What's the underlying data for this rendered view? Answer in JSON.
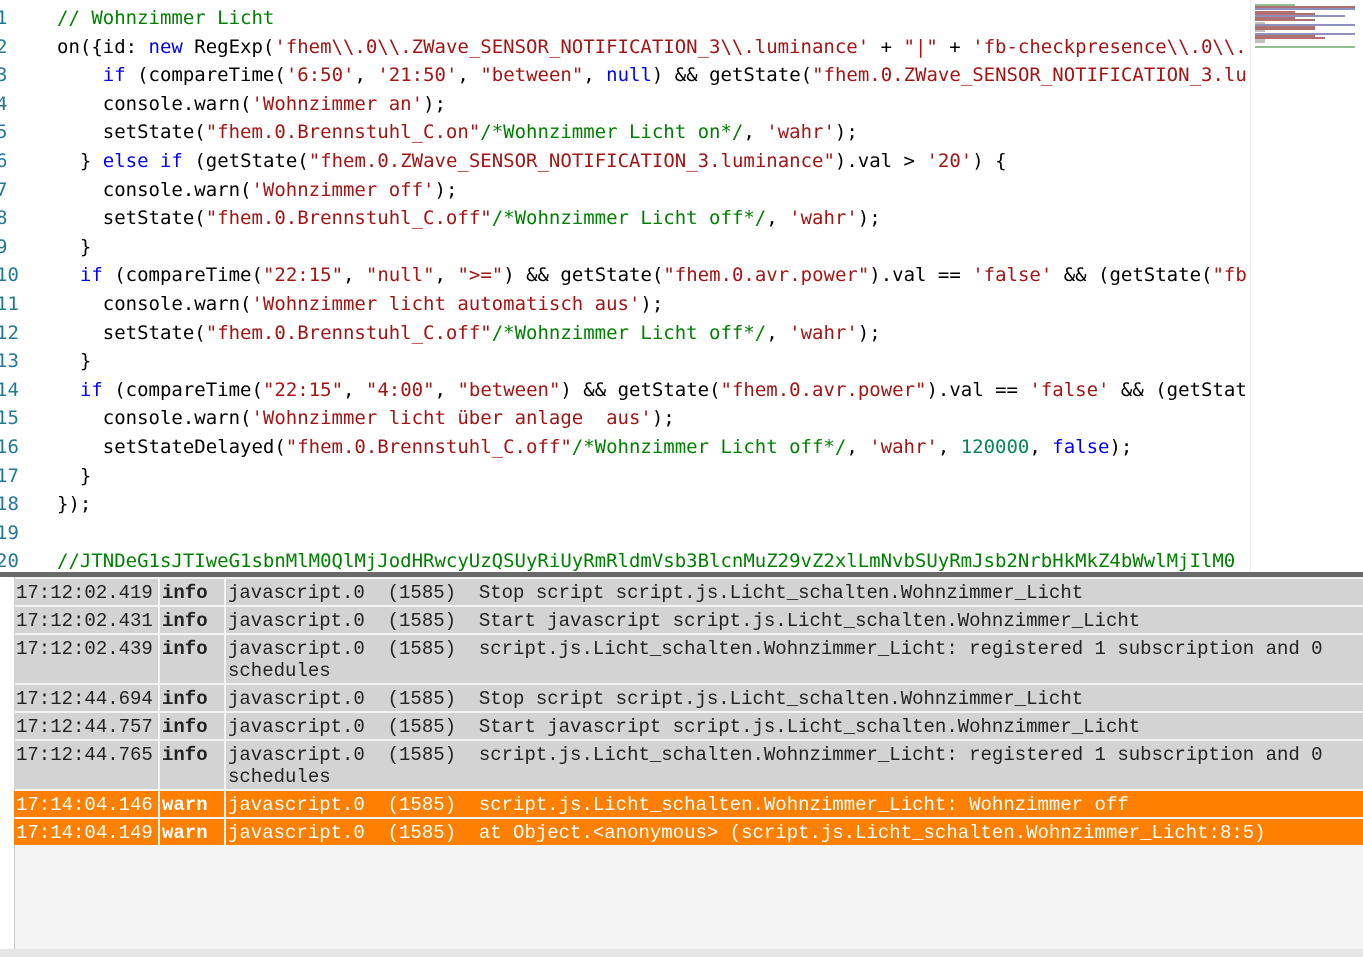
{
  "editor": {
    "lines": [
      {
        "n": "1",
        "tokens": [
          {
            "t": "// Wohnzimmer Licht",
            "c": "com"
          }
        ]
      },
      {
        "n": "2",
        "tokens": [
          {
            "t": "on({id: ",
            "c": "plain"
          },
          {
            "t": "new",
            "c": "kw"
          },
          {
            "t": " RegExp(",
            "c": "plain"
          },
          {
            "t": "'fhem\\\\.0\\\\.ZWave_SENSOR_NOTIFICATION_3\\\\.luminance'",
            "c": "str"
          },
          {
            "t": " + ",
            "c": "plain"
          },
          {
            "t": "\"|\"",
            "c": "str"
          },
          {
            "t": " + ",
            "c": "plain"
          },
          {
            "t": "'fb-checkpresence\\\\.0\\\\.",
            "c": "str"
          }
        ]
      },
      {
        "n": "3",
        "tokens": [
          {
            "t": "    ",
            "c": "plain"
          },
          {
            "t": "if",
            "c": "kw"
          },
          {
            "t": " (compareTime(",
            "c": "plain"
          },
          {
            "t": "'6:50'",
            "c": "str"
          },
          {
            "t": ", ",
            "c": "plain"
          },
          {
            "t": "'21:50'",
            "c": "str"
          },
          {
            "t": ", ",
            "c": "plain"
          },
          {
            "t": "\"between\"",
            "c": "str"
          },
          {
            "t": ", ",
            "c": "plain"
          },
          {
            "t": "null",
            "c": "kw"
          },
          {
            "t": ") && getState(",
            "c": "plain"
          },
          {
            "t": "\"fhem.0.ZWave_SENSOR_NOTIFICATION_3.lu",
            "c": "str"
          }
        ]
      },
      {
        "n": "4",
        "tokens": [
          {
            "t": "    console.warn(",
            "c": "plain"
          },
          {
            "t": "'Wohnzimmer an'",
            "c": "str"
          },
          {
            "t": ");",
            "c": "plain"
          }
        ]
      },
      {
        "n": "5",
        "tokens": [
          {
            "t": "    setState(",
            "c": "plain"
          },
          {
            "t": "\"fhem.0.Brennstuhl_C.on\"",
            "c": "str"
          },
          {
            "t": "/*Wohnzimmer Licht on*/",
            "c": "com"
          },
          {
            "t": ", ",
            "c": "plain"
          },
          {
            "t": "'wahr'",
            "c": "str"
          },
          {
            "t": ");",
            "c": "plain"
          }
        ]
      },
      {
        "n": "6",
        "tokens": [
          {
            "t": "  } ",
            "c": "plain"
          },
          {
            "t": "else",
            "c": "kw"
          },
          {
            "t": " ",
            "c": "plain"
          },
          {
            "t": "if",
            "c": "kw"
          },
          {
            "t": " (getState(",
            "c": "plain"
          },
          {
            "t": "\"fhem.0.ZWave_SENSOR_NOTIFICATION_3.luminance\"",
            "c": "str"
          },
          {
            "t": ").val > ",
            "c": "plain"
          },
          {
            "t": "'20'",
            "c": "str"
          },
          {
            "t": ") {",
            "c": "plain"
          }
        ]
      },
      {
        "n": "7",
        "tokens": [
          {
            "t": "    console.warn(",
            "c": "plain"
          },
          {
            "t": "'Wohnzimmer off'",
            "c": "str"
          },
          {
            "t": ");",
            "c": "plain"
          }
        ]
      },
      {
        "n": "8",
        "tokens": [
          {
            "t": "    setState(",
            "c": "plain"
          },
          {
            "t": "\"fhem.0.Brennstuhl_C.off\"",
            "c": "str"
          },
          {
            "t": "/*Wohnzimmer Licht off*/",
            "c": "com"
          },
          {
            "t": ", ",
            "c": "plain"
          },
          {
            "t": "'wahr'",
            "c": "str"
          },
          {
            "t": ");",
            "c": "plain"
          }
        ]
      },
      {
        "n": "9",
        "tokens": [
          {
            "t": "  }",
            "c": "plain"
          }
        ]
      },
      {
        "n": "10",
        "tokens": [
          {
            "t": "  ",
            "c": "plain"
          },
          {
            "t": "if",
            "c": "kw"
          },
          {
            "t": " (compareTime(",
            "c": "plain"
          },
          {
            "t": "\"22:15\"",
            "c": "str"
          },
          {
            "t": ", ",
            "c": "plain"
          },
          {
            "t": "\"null\"",
            "c": "str"
          },
          {
            "t": ", ",
            "c": "plain"
          },
          {
            "t": "\">=\"",
            "c": "str"
          },
          {
            "t": ") && getState(",
            "c": "plain"
          },
          {
            "t": "\"fhem.0.avr.power\"",
            "c": "str"
          },
          {
            "t": ").val == ",
            "c": "plain"
          },
          {
            "t": "'false'",
            "c": "str"
          },
          {
            "t": " && (getState(",
            "c": "plain"
          },
          {
            "t": "\"fb",
            "c": "str"
          }
        ]
      },
      {
        "n": "11",
        "tokens": [
          {
            "t": "    console.warn(",
            "c": "plain"
          },
          {
            "t": "'Wohnzimmer licht automatisch aus'",
            "c": "str"
          },
          {
            "t": ");",
            "c": "plain"
          }
        ]
      },
      {
        "n": "12",
        "tokens": [
          {
            "t": "    setState(",
            "c": "plain"
          },
          {
            "t": "\"fhem.0.Brennstuhl_C.off\"",
            "c": "str"
          },
          {
            "t": "/*Wohnzimmer Licht off*/",
            "c": "com"
          },
          {
            "t": ", ",
            "c": "plain"
          },
          {
            "t": "'wahr'",
            "c": "str"
          },
          {
            "t": ");",
            "c": "plain"
          }
        ]
      },
      {
        "n": "13",
        "tokens": [
          {
            "t": "  }",
            "c": "plain"
          }
        ]
      },
      {
        "n": "14",
        "tokens": [
          {
            "t": "  ",
            "c": "plain"
          },
          {
            "t": "if",
            "c": "kw"
          },
          {
            "t": " (compareTime(",
            "c": "plain"
          },
          {
            "t": "\"22:15\"",
            "c": "str"
          },
          {
            "t": ", ",
            "c": "plain"
          },
          {
            "t": "\"4:00\"",
            "c": "str"
          },
          {
            "t": ", ",
            "c": "plain"
          },
          {
            "t": "\"between\"",
            "c": "str"
          },
          {
            "t": ") && getState(",
            "c": "plain"
          },
          {
            "t": "\"fhem.0.avr.power\"",
            "c": "str"
          },
          {
            "t": ").val == ",
            "c": "plain"
          },
          {
            "t": "'false'",
            "c": "str"
          },
          {
            "t": " && (getStat",
            "c": "plain"
          }
        ]
      },
      {
        "n": "15",
        "tokens": [
          {
            "t": "    console.warn(",
            "c": "plain"
          },
          {
            "t": "'Wohnzimmer licht über anlage  aus'",
            "c": "str"
          },
          {
            "t": ");",
            "c": "plain"
          }
        ]
      },
      {
        "n": "16",
        "tokens": [
          {
            "t": "    setStateDelayed(",
            "c": "plain"
          },
          {
            "t": "\"fhem.0.Brennstuhl_C.off\"",
            "c": "str"
          },
          {
            "t": "/*Wohnzimmer Licht off*/",
            "c": "com"
          },
          {
            "t": ", ",
            "c": "plain"
          },
          {
            "t": "'wahr'",
            "c": "str"
          },
          {
            "t": ", ",
            "c": "plain"
          },
          {
            "t": "120000",
            "c": "num"
          },
          {
            "t": ", ",
            "c": "plain"
          },
          {
            "t": "false",
            "c": "kw"
          },
          {
            "t": ");",
            "c": "plain"
          }
        ]
      },
      {
        "n": "17",
        "tokens": [
          {
            "t": "  }",
            "c": "plain"
          }
        ]
      },
      {
        "n": "18",
        "tokens": [
          {
            "t": "});",
            "c": "plain"
          }
        ]
      },
      {
        "n": "19",
        "tokens": []
      },
      {
        "n": "20",
        "tokens": [
          {
            "t": "//JTNDeG1sJTIweG1sbnMlM0QlMjJodHRwcyUzQSUyRiUyRmRldmVsb3BlcnMuZ29vZ2xlLmNvbSUyRmJsb2NrbHkMkZ4bWwlMjIlM0",
            "c": "com"
          }
        ]
      }
    ]
  },
  "log": {
    "rows": [
      {
        "time": "17:12:02.419",
        "severity": "info",
        "message": "javascript.0  (1585)  Stop script script.js.Licht_schalten.Wohnzimmer_Licht"
      },
      {
        "time": "17:12:02.431",
        "severity": "info",
        "message": "javascript.0  (1585)  Start javascript script.js.Licht_schalten.Wohnzimmer_Licht"
      },
      {
        "time": "17:12:02.439",
        "severity": "info",
        "message": "javascript.0  (1585)  script.js.Licht_schalten.Wohnzimmer_Licht: registered 1 subscription and 0 schedules"
      },
      {
        "time": "17:12:44.694",
        "severity": "info",
        "message": "javascript.0  (1585)  Stop script script.js.Licht_schalten.Wohnzimmer_Licht"
      },
      {
        "time": "17:12:44.757",
        "severity": "info",
        "message": "javascript.0  (1585)  Start javascript script.js.Licht_schalten.Wohnzimmer_Licht"
      },
      {
        "time": "17:12:44.765",
        "severity": "info",
        "message": "javascript.0  (1585)  script.js.Licht_schalten.Wohnzimmer_Licht: registered 1 subscription and 0 schedules"
      },
      {
        "time": "17:14:04.146",
        "severity": "warn",
        "message": "javascript.0  (1585)  script.js.Licht_schalten.Wohnzimmer_Licht: Wohnzimmer off"
      },
      {
        "time": "17:14:04.149",
        "severity": "warn",
        "message": "javascript.0  (1585)  at Object.<anonymous> (script.js.Licht_schalten.Wohnzimmer_Licht:8:5)"
      }
    ]
  },
  "colors": {
    "keyword": "#0000ff",
    "string": "#a31515",
    "comment": "#008000",
    "number": "#098658",
    "line_number": "#237893",
    "log_info_bg": "#d3d3d3",
    "log_warn_bg": "#ff8000"
  }
}
